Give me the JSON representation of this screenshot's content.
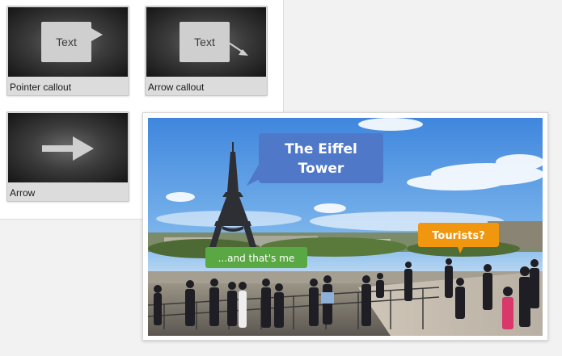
{
  "tiles": [
    {
      "label": "Pointer callout",
      "preview_text": "Text"
    },
    {
      "label": "Arrow callout",
      "preview_text": "Text"
    },
    {
      "label": "Arrow"
    }
  ],
  "photo": {
    "callouts": [
      {
        "line1": "The Eiffel",
        "line2": "Tower",
        "color": "#4f78c8"
      },
      {
        "text": "...and that's me",
        "color": "#5aa844"
      },
      {
        "text": "Tourists?",
        "color": "#f0960f"
      }
    ]
  },
  "colors": {
    "tile_bg": "#dcdcdc",
    "preview_dark": "#151515",
    "sky": "#4d8fe0",
    "callout_blue": "#4f78c8",
    "callout_green": "#5aa844",
    "callout_orange": "#f0960f"
  }
}
